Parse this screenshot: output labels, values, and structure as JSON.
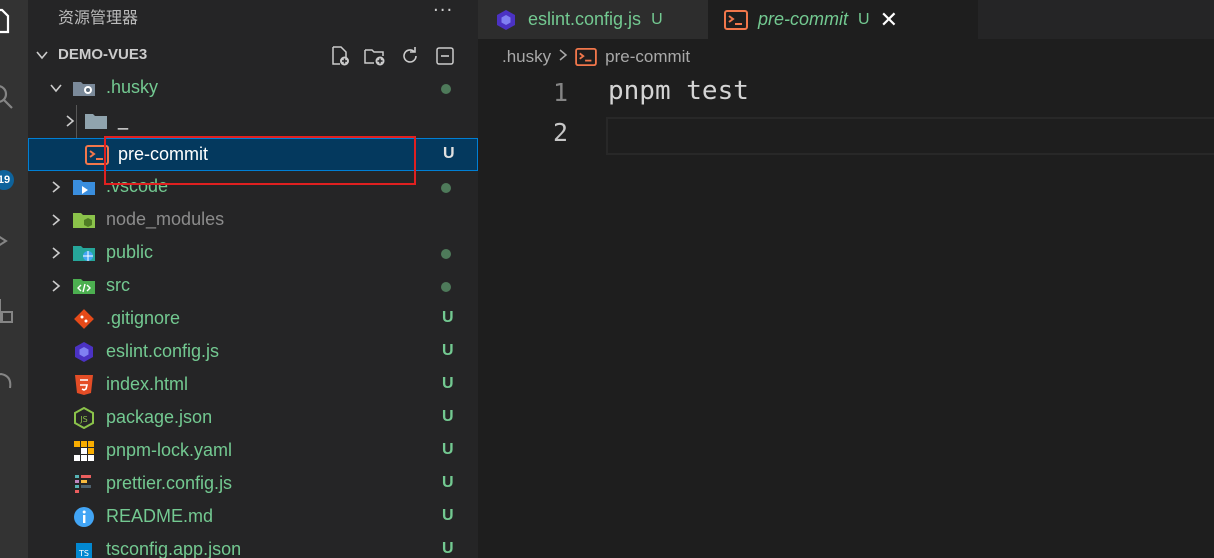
{
  "explorer": {
    "title": "资源管理器",
    "more": "···",
    "root_label": "DEMO-VUE3",
    "badge_count": "19"
  },
  "tree": [
    {
      "name": ".husky",
      "status": "",
      "kind": "folder-open",
      "icon": "husky-folder-icon",
      "color": "green"
    },
    {
      "name": "_",
      "status": "",
      "kind": "folder",
      "icon": "folder-icon",
      "color": "white"
    },
    {
      "name": "pre-commit",
      "status": "U",
      "kind": "file",
      "icon": "terminal-icon",
      "color": "white",
      "selected": true
    },
    {
      "name": ".vscode",
      "status": "",
      "kind": "folder",
      "icon": "vscode-folder-icon",
      "color": "green"
    },
    {
      "name": "node_modules",
      "status": "",
      "kind": "folder",
      "icon": "node-folder-icon",
      "color": "grey"
    },
    {
      "name": "public",
      "status": "",
      "kind": "folder",
      "icon": "public-folder-icon",
      "color": "green"
    },
    {
      "name": "src",
      "status": "",
      "kind": "folder",
      "icon": "src-folder-icon",
      "color": "green"
    },
    {
      "name": ".gitignore",
      "status": "U",
      "kind": "file",
      "icon": "git-icon",
      "color": "green"
    },
    {
      "name": "eslint.config.js",
      "status": "U",
      "kind": "file",
      "icon": "eslint-icon",
      "color": "green"
    },
    {
      "name": "index.html",
      "status": "U",
      "kind": "file",
      "icon": "html5-icon",
      "color": "green"
    },
    {
      "name": "package.json",
      "status": "U",
      "kind": "file",
      "icon": "nodejs-icon",
      "color": "green"
    },
    {
      "name": "pnpm-lock.yaml",
      "status": "U",
      "kind": "file",
      "icon": "pnpm-icon",
      "color": "green"
    },
    {
      "name": "prettier.config.js",
      "status": "U",
      "kind": "file",
      "icon": "prettier-icon",
      "color": "green"
    },
    {
      "name": "README.md",
      "status": "U",
      "kind": "file",
      "icon": "info-icon",
      "color": "green"
    },
    {
      "name": "tsconfig.app.json",
      "status": "U",
      "kind": "file",
      "icon": "tsconfig-icon",
      "color": "green"
    }
  ],
  "tabs": [
    {
      "name": "eslint.config.js",
      "status": "U",
      "icon": "eslint-icon",
      "active": false
    },
    {
      "name": "pre-commit",
      "status": "U",
      "icon": "terminal-icon",
      "active": true
    }
  ],
  "breadcrumb": {
    "folder": ".husky",
    "file": "pre-commit"
  },
  "editor": {
    "lines": [
      {
        "num": "1",
        "text": "pnpm test"
      },
      {
        "num": "2",
        "text": ""
      }
    ]
  },
  "colors": {
    "accent": "#007fd4",
    "untracked": "#73c991",
    "annotation": "#e02020"
  }
}
